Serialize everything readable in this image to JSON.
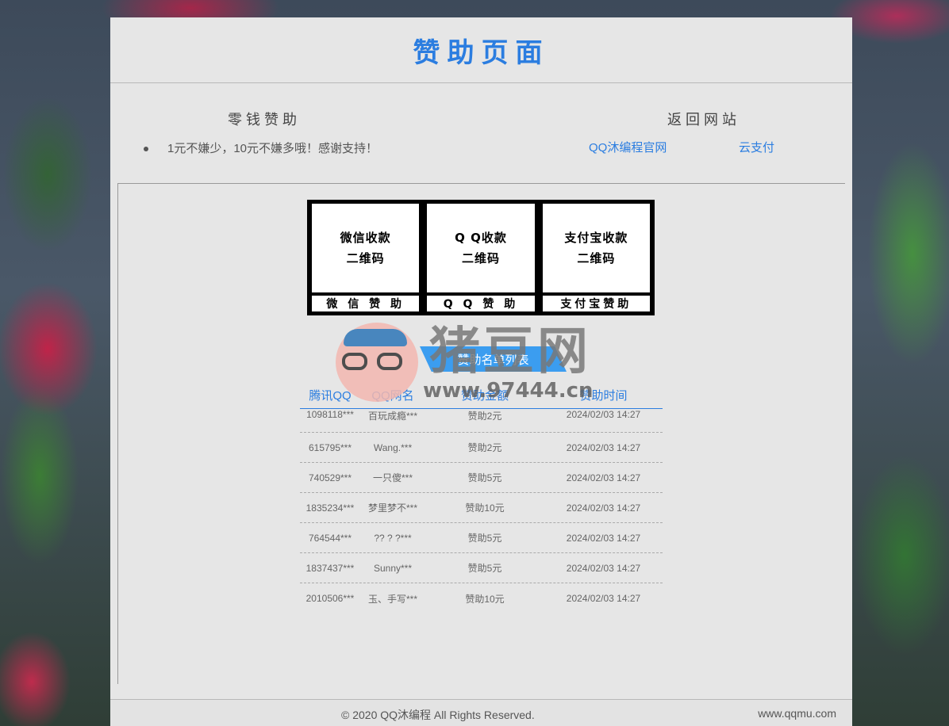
{
  "header": {
    "title": "赞助页面"
  },
  "donate": {
    "title": "零钱赞助",
    "note": "1元不嫌少，10元不嫌多哦！感谢支持！"
  },
  "return": {
    "title": "返回网站",
    "links": [
      "QQ沐编程官网",
      "云支付"
    ]
  },
  "qr": [
    {
      "line1": "微信收款",
      "line2": "二维码",
      "label": "微 信 赞 助"
    },
    {
      "line1": "Q Q收款",
      "line2": "二维码",
      "label": "Q Q 赞 助"
    },
    {
      "line1": "支付宝收款",
      "line2": "二维码",
      "label": "支付宝赞助"
    }
  ],
  "list_button": "赞助名单列表",
  "table": {
    "headers": [
      "腾讯QQ",
      "QQ网名",
      "赞助金额",
      "赞助时间"
    ],
    "rows": [
      [
        "1098118***",
        "百玩成瘾***",
        "赞助2元",
        "2024/02/03 14:27"
      ],
      [
        "615795***",
        "Wang.***",
        "赞助2元",
        "2024/02/03 14:27"
      ],
      [
        "740529***",
        "一只傻***",
        "赞助5元",
        "2024/02/03 14:27"
      ],
      [
        "1835234***",
        "梦里梦不***",
        "赞助10元",
        "2024/02/03 14:27"
      ],
      [
        "764544***",
        "?? ? ?***",
        "赞助5元",
        "2024/02/03 14:27"
      ],
      [
        "1837437***",
        "Sunny***",
        "赞助5元",
        "2024/02/03 14:27"
      ],
      [
        "2010506***",
        "玉、手写***",
        "赞助10元",
        "2024/02/03 14:27"
      ]
    ]
  },
  "footer": {
    "copyright": "© 2020 QQ沐编程 All Rights Reserved.",
    "site": "www.qqmu.com"
  },
  "watermark": {
    "title": "猪豆网",
    "url": "www.97444.cn"
  },
  "colors": {
    "accent": "#2b7de0",
    "button": "#3b9df0",
    "panel": "#e6e6e6"
  }
}
